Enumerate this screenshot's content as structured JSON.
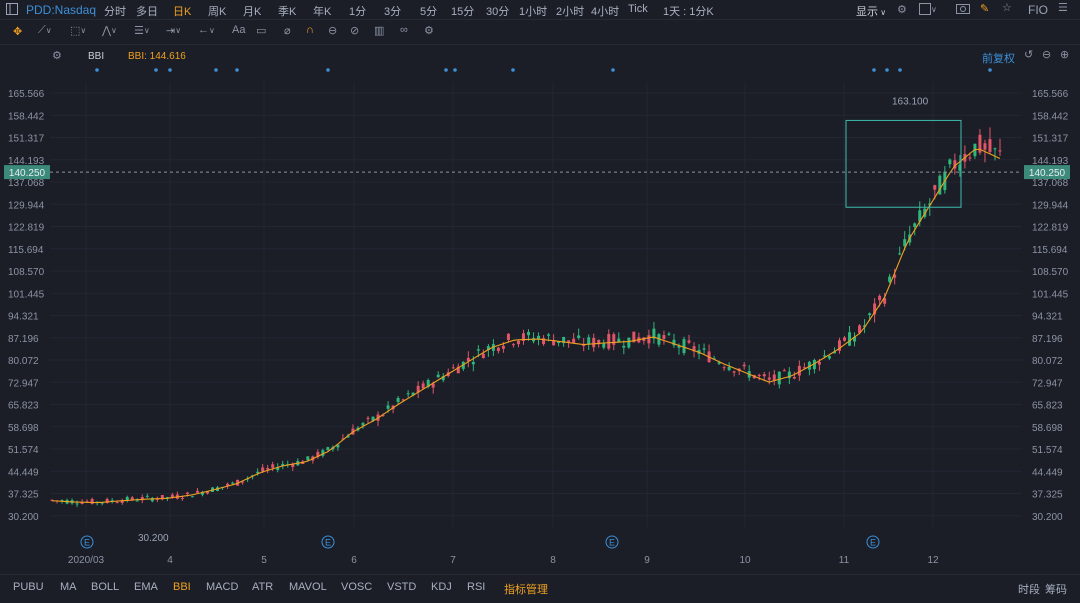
{
  "symbol": "PDD:Nasdaq",
  "timeframes": [
    "分时",
    "多日",
    "日K",
    "周K",
    "月K",
    "季K",
    "年K",
    "1分",
    "3分",
    "5分",
    "15分",
    "30分",
    "1小时",
    "2小时",
    "4小时",
    "Tick",
    "1天 : 1分K"
  ],
  "active_timeframe": "日K",
  "display_label": "显示",
  "fio_label": "FIO",
  "indicator": {
    "name": "BBI",
    "label": "BBI: 144.616"
  },
  "adjust_label": "前复权",
  "current_price": "140.250",
  "y_axis_ticks": [
    "165.566",
    "158.442",
    "151.317",
    "144.193",
    "137.068",
    "129.944",
    "122.819",
    "115.694",
    "108.570",
    "101.445",
    "94.321",
    "87.196",
    "80.072",
    "72.947",
    "65.823",
    "58.698",
    "51.574",
    "44.449",
    "37.325",
    "30.200"
  ],
  "x_axis_labels": [
    "2020/03",
    "4",
    "5",
    "6",
    "7",
    "8",
    "9",
    "10",
    "11",
    "12"
  ],
  "annotations": {
    "high": "163.100",
    "low": "30.200",
    "earnings_marker": "E"
  },
  "bottom_indicators": [
    "PUBU",
    "MA",
    "BOLL",
    "EMA",
    "BBI",
    "MACD",
    "ATR",
    "MAVOL",
    "VOSC",
    "VSTD",
    "KDJ",
    "RSI",
    "指标管理"
  ],
  "active_bottom": "BBI",
  "bottom_right": [
    "时段",
    "筹码"
  ],
  "colors": {
    "up": "#e05567",
    "down": "#2fb67a",
    "bbi": "#f0a020",
    "accent": "#3d8fd6"
  },
  "chart_data": {
    "type": "candlestick",
    "ylim": [
      26.6,
      169.1
    ],
    "series": [
      {
        "name": "BBI",
        "values": [
          35,
          34.6,
          34.4,
          35,
          35.5,
          35.8,
          36.8,
          38.5,
          40.5,
          44,
          46.2,
          47.5,
          51,
          57,
          61,
          66,
          70.5,
          75,
          79.5,
          84,
          86.5,
          86.8,
          86,
          85,
          85.6,
          86,
          87.5,
          85,
          82.5,
          79,
          76,
          73,
          75,
          79,
          83.5,
          89,
          100,
          118,
          130,
          142,
          148,
          144.6
        ]
      }
    ]
  }
}
